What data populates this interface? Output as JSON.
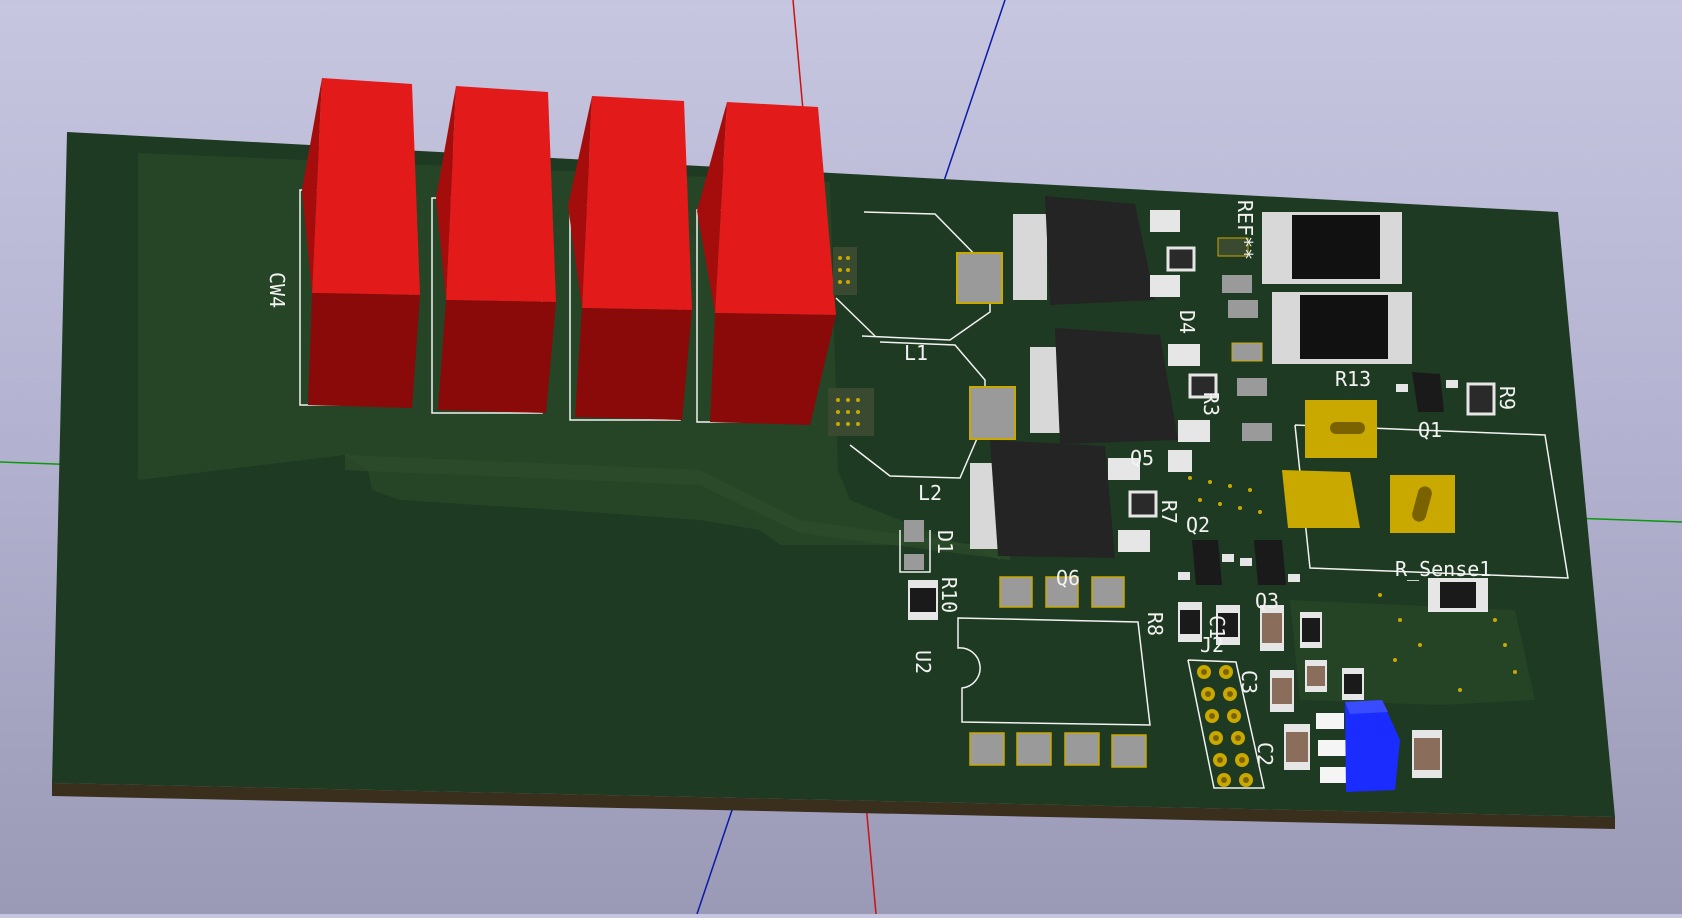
{
  "viewer": {
    "colors": {
      "background_top": "#c6c6e0",
      "background_bottom": "#9a9ab6",
      "board": "#1e3a22",
      "board_edge": "#3a2e1c",
      "copper_zone": "#2a4a28",
      "silkscreen": "#f2f2f2",
      "capacitor": "#d40d0d",
      "pad_gold": "#c9a800",
      "pad_tin": "#9a9a9a",
      "ic_body": "#222222",
      "pot_body": "#1a2cff",
      "axis_x": "#cc1111",
      "axis_y": "#0a9a0a",
      "axis_z": "#0a1aa8"
    }
  },
  "board": {
    "labels": {
      "cw4": "CW4",
      "l1": "L1",
      "l2": "L2",
      "ref": "REF**",
      "d4": "D4",
      "r13": "R13",
      "r9": "R9",
      "q1": "Q1",
      "q2": "Q2",
      "r7": "R7",
      "q6": "Q6",
      "d1": "D1",
      "r10": "R10",
      "u2": "U2",
      "r8": "R8",
      "q3": "Q3",
      "r_sense1": "R_Sense1",
      "c2": "C2",
      "c3": "C3",
      "c1": "C1",
      "j2": "J2",
      "r3": "R3",
      "q5": "Q5"
    }
  }
}
